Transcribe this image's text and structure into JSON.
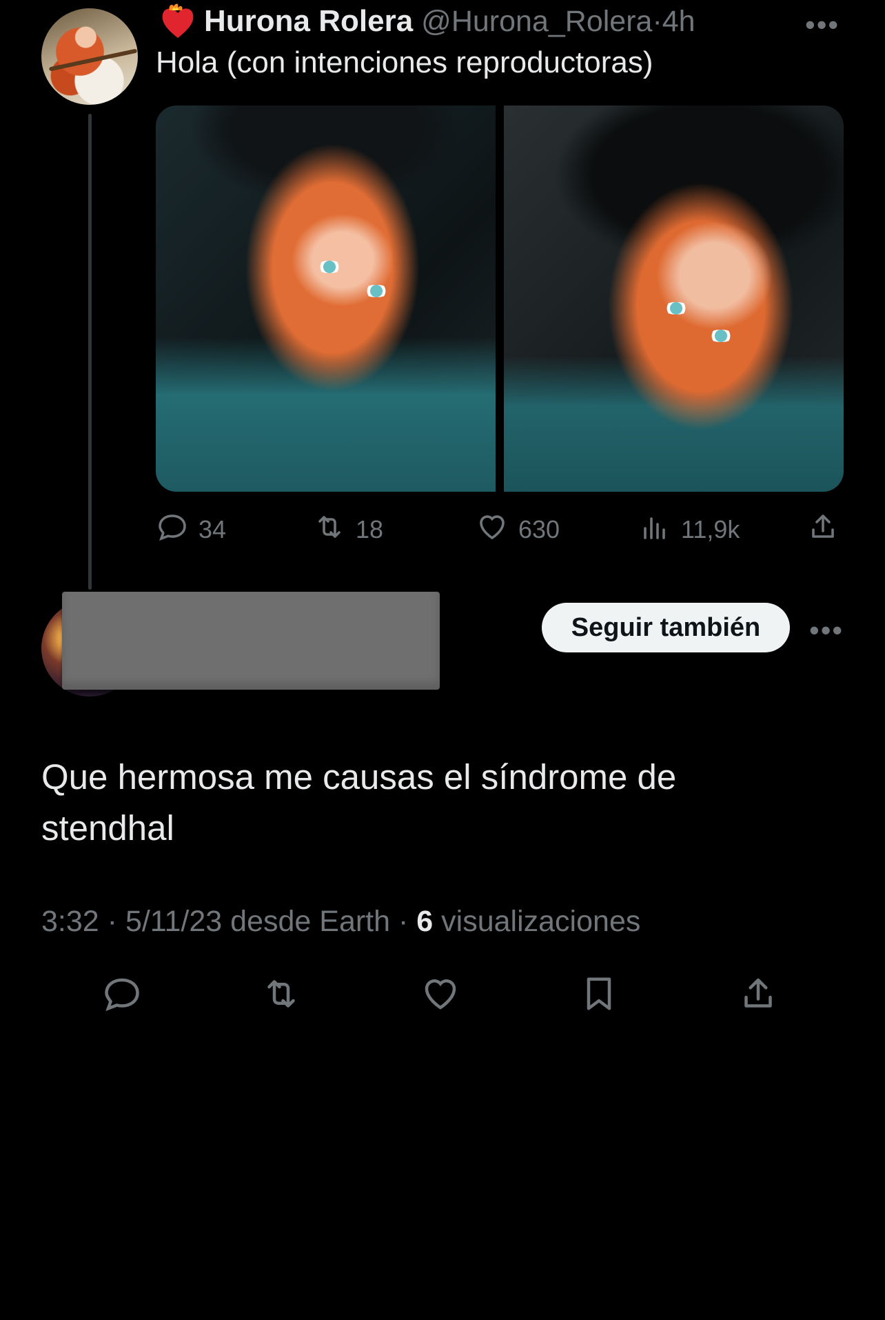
{
  "original_tweet": {
    "display_name": "Hurona Rolera",
    "handle": "@Hurona_Rolera",
    "separator": "·",
    "time_ago": "4h",
    "text": "Hola (con intenciones reproductoras)",
    "more_label": "•••",
    "stats": {
      "replies": "34",
      "retweets": "18",
      "likes": "630",
      "views": "11,9k"
    }
  },
  "reply": {
    "follow_button_label": "Seguir también",
    "more_label": "•••",
    "text": "Que hermosa me causas el síndrome de stendhal",
    "meta": {
      "time": "3:32",
      "date_source": "5/11/23 desde Earth",
      "separator": "·",
      "views_count": "6",
      "views_label": "visualizaciones"
    }
  },
  "colors": {
    "background": "#000000",
    "text_primary": "#e7e9ea",
    "text_secondary": "#71767b",
    "thread_line": "#333639",
    "follow_button_bg": "#eff3f4",
    "redaction_gray": "#6f6f70"
  },
  "icons": [
    "heart-fire-emoji-icon",
    "reply-icon",
    "retweet-icon",
    "like-icon",
    "views-icon",
    "share-icon",
    "bookmark-icon",
    "more-icon"
  ]
}
